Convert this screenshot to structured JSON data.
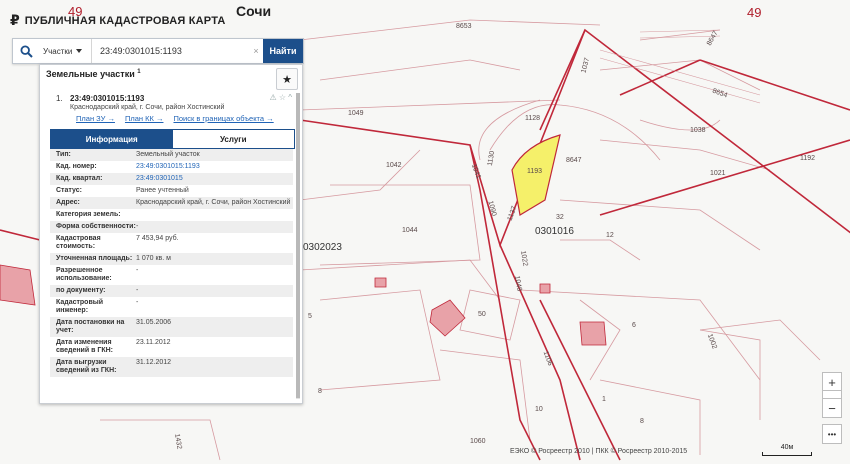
{
  "app": {
    "title": "ПУБЛИЧНАЯ КАДАСТРОВАЯ КАРТА",
    "logo_glyph": "₽"
  },
  "search": {
    "type_label": "Участки",
    "query": "23:49:0301015:1193",
    "button": "Найти",
    "clear": "×"
  },
  "panel": {
    "title": "Земельные участки",
    "count": "1",
    "star": "★",
    "item": {
      "index": "1.",
      "cad_number": "23:49:0301015:1193",
      "address": "Краснодарский край, г. Сочи, район Хостинский",
      "tools": "⚠ ☆ ^",
      "links": [
        "План ЗУ →",
        "План КК →",
        "Поиск в границах объекта →"
      ]
    },
    "tabs": [
      "Информация",
      "Услуги"
    ],
    "info_rows": [
      {
        "k": "Тип:",
        "v": "Земельный участок"
      },
      {
        "k": "Кад. номер:",
        "v": "23:49:0301015:1193",
        "link": true
      },
      {
        "k": "Кад. квартал:",
        "v": "23:49:0301015",
        "link": true
      },
      {
        "k": "Статус:",
        "v": "Ранее учтенный"
      },
      {
        "k": "Адрес:",
        "v": "Краснодарский край, г. Сочи, район Хостинский"
      },
      {
        "k": "Категория земель:",
        "v": ""
      },
      {
        "k": "Форма собственности:",
        "v": "-"
      },
      {
        "k": "Кадастровая стоимость:",
        "v": "7 453,94 руб."
      },
      {
        "k": "Уточненная площадь:",
        "v": "1 070 кв. м"
      },
      {
        "k": "Разрешенное использование:",
        "v": "-"
      },
      {
        "k": "по документу:",
        "v": "-"
      },
      {
        "k": "Кадастровый инженер:",
        "v": "-"
      },
      {
        "k": "Дата постановки на учет:",
        "v": "31.05.2006"
      },
      {
        "k": "Дата изменения сведений в ГКН:",
        "v": "23.11.2012"
      },
      {
        "k": "Дата выгрузки сведений из ГКН:",
        "v": "31.12.2012"
      }
    ]
  },
  "map": {
    "city": "Сочи",
    "labels": [
      "49",
      "49",
      "8653",
      "1037",
      "8647",
      "8654",
      "1049",
      "1128",
      "1038",
      "1192",
      "1042",
      "1130",
      "1193",
      "8647",
      "1021",
      "1041",
      "1090",
      "1137",
      "32",
      "0301016",
      "12",
      "1044",
      "0302023",
      "1022",
      "1048",
      "5",
      "50",
      "6",
      "1002",
      "8",
      "1106",
      "10",
      "1432",
      "1060",
      "1",
      "8"
    ]
  },
  "controls": {
    "zoom_in": "+",
    "more": "•••",
    "zoom_out": "−",
    "menu": "•••"
  },
  "footer": {
    "copyright": "ЕЭКО © Росреестр 2010 | ПКК © Росреестр 2010-2015",
    "scale": "40м"
  },
  "colors": {
    "accent": "#1c4f8b",
    "boundary": "#c0283a",
    "selected_fill": "#f5f06a"
  }
}
